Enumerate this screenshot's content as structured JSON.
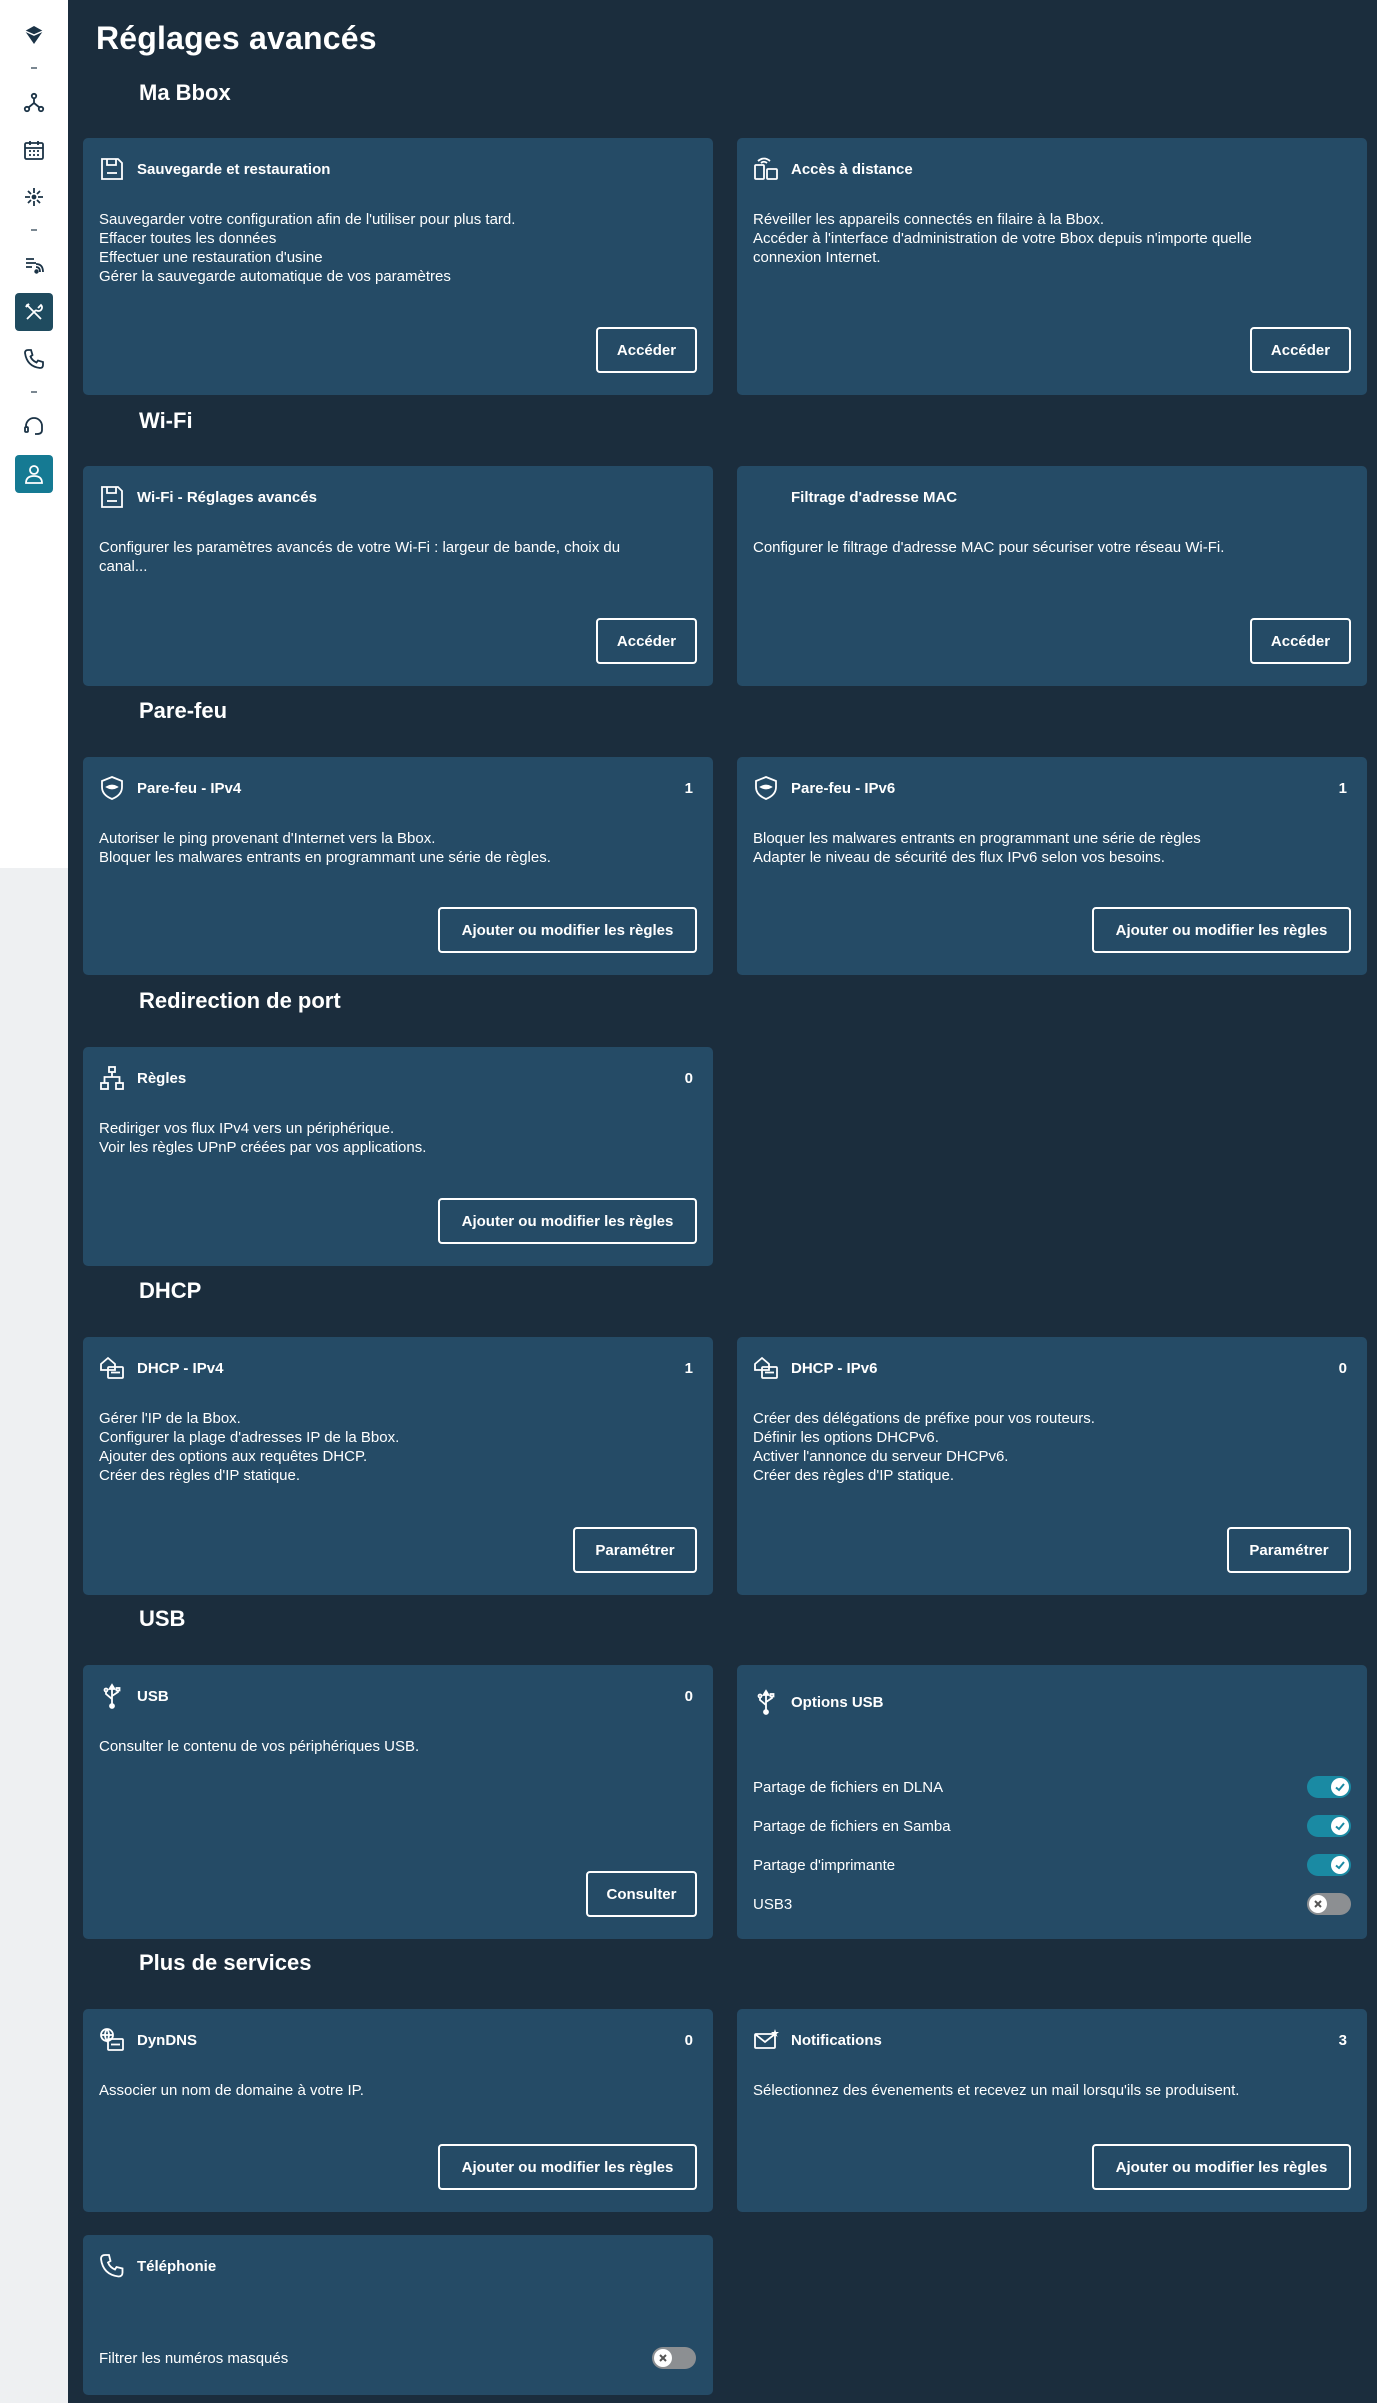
{
  "page_title": "Réglages avancés",
  "sidebar": {
    "items": [
      {
        "icon": "bbox-logo-icon"
      },
      {
        "icon": "network-icon"
      },
      {
        "icon": "calendar-icon"
      },
      {
        "icon": "sparkle-icon"
      },
      {
        "icon": "wifi-signal-icon"
      },
      {
        "icon": "tools-icon",
        "active": true
      },
      {
        "icon": "phone-icon"
      },
      {
        "icon": "support-icon"
      },
      {
        "icon": "profile-icon"
      }
    ]
  },
  "sections": {
    "ma_bbox": "Ma Bbox",
    "wifi": "Wi-Fi",
    "parefeu": "Pare-feu",
    "redirection": "Redirection de port",
    "dhcp": "DHCP",
    "usb": "USB",
    "services": "Plus de services"
  },
  "cards": {
    "sauvegarde": {
      "title": "Sauvegarde et restauration",
      "desc": [
        "Sauvegarder votre configuration afin de l'utiliser pour plus tard.",
        "Effacer toutes les données",
        "Effectuer une restauration d'usine",
        "Gérer la sauvegarde automatique de vos paramètres"
      ],
      "button": "Accéder"
    },
    "acces_distance": {
      "title": "Accès à distance",
      "desc": [
        "Réveiller les appareils connectés en filaire à la Bbox.",
        "Accéder à l'interface d'administration de votre Bbox depuis n'importe quelle",
        "connexion Internet."
      ],
      "button": "Accéder"
    },
    "wifi_avances": {
      "title": "Wi-Fi - Réglages avancés",
      "desc": [
        "Configurer les paramètres avancés de votre Wi-Fi : largeur de bande, choix du",
        "canal..."
      ],
      "button": "Accéder"
    },
    "filtrage_mac": {
      "title": "Filtrage d'adresse MAC",
      "desc": [
        "Configurer le filtrage d'adresse MAC pour sécuriser votre réseau Wi-Fi."
      ],
      "button": "Accéder"
    },
    "parefeu_ipv4": {
      "title": "Pare-feu - IPv4",
      "count": "1",
      "desc": [
        "Autoriser le ping provenant d'Internet vers la Bbox.",
        "Bloquer les malwares entrants en programmant une série de règles."
      ],
      "button": "Ajouter ou modifier les règles"
    },
    "parefeu_ipv6": {
      "title": "Pare-feu - IPv6",
      "count": "1",
      "desc": [
        "Bloquer les malwares entrants en programmant une série de règles",
        "Adapter le niveau de sécurité des flux IPv6 selon vos besoins."
      ],
      "button": "Ajouter ou modifier les règles"
    },
    "regles": {
      "title": "Règles",
      "count": "0",
      "desc": [
        "Rediriger vos flux IPv4 vers un périphérique.",
        "Voir les règles UPnP créées par vos applications."
      ],
      "button": "Ajouter ou modifier les règles"
    },
    "dhcp_ipv4": {
      "title": "DHCP - IPv4",
      "count": "1",
      "desc": [
        "Gérer l'IP de la Bbox.",
        "Configurer la plage d'adresses IP de la Bbox.",
        "Ajouter des options aux requêtes DHCP.",
        "Créer des règles d'IP statique."
      ],
      "button": "Paramétrer"
    },
    "dhcp_ipv6": {
      "title": "DHCP - IPv6",
      "count": "0",
      "desc": [
        "Créer des délégations de préfixe pour vos routeurs.",
        "Définir les options DHCPv6.",
        "Activer l'annonce du serveur DHCPv6.",
        "Créer des règles d'IP statique."
      ],
      "button": "Paramétrer"
    },
    "usb": {
      "title": "USB",
      "count": "0",
      "desc": [
        "Consulter le contenu de vos périphériques USB."
      ],
      "button": "Consulter"
    },
    "options_usb": {
      "title": "Options USB",
      "toggles": [
        {
          "label": "Partage de fichiers en DLNA",
          "on": true
        },
        {
          "label": "Partage de fichiers en Samba",
          "on": true
        },
        {
          "label": "Partage d'imprimante",
          "on": true
        },
        {
          "label": "USB3",
          "on": false
        }
      ]
    },
    "dyndns": {
      "title": "DynDNS",
      "count": "0",
      "desc": [
        "Associer un nom de domaine à votre IP."
      ],
      "button": "Ajouter ou modifier les règles"
    },
    "notifications": {
      "title": "Notifications",
      "count": "3",
      "desc": [
        "Sélectionnez des évenements et recevez un mail lorsqu'ils se produisent."
      ],
      "button": "Ajouter ou modifier les règles"
    },
    "telephonie": {
      "title": "Téléphonie",
      "toggles": [
        {
          "label": "Filtrer les numéros masqués",
          "on": false
        }
      ]
    }
  },
  "colors": {
    "background": "#1b2d3d",
    "card": "#254b66",
    "toggle_on": "#1a8aa3",
    "toggle_off": "#8c8f92",
    "sidebar_active": "#1f4b5f",
    "profile": "#157a93"
  }
}
